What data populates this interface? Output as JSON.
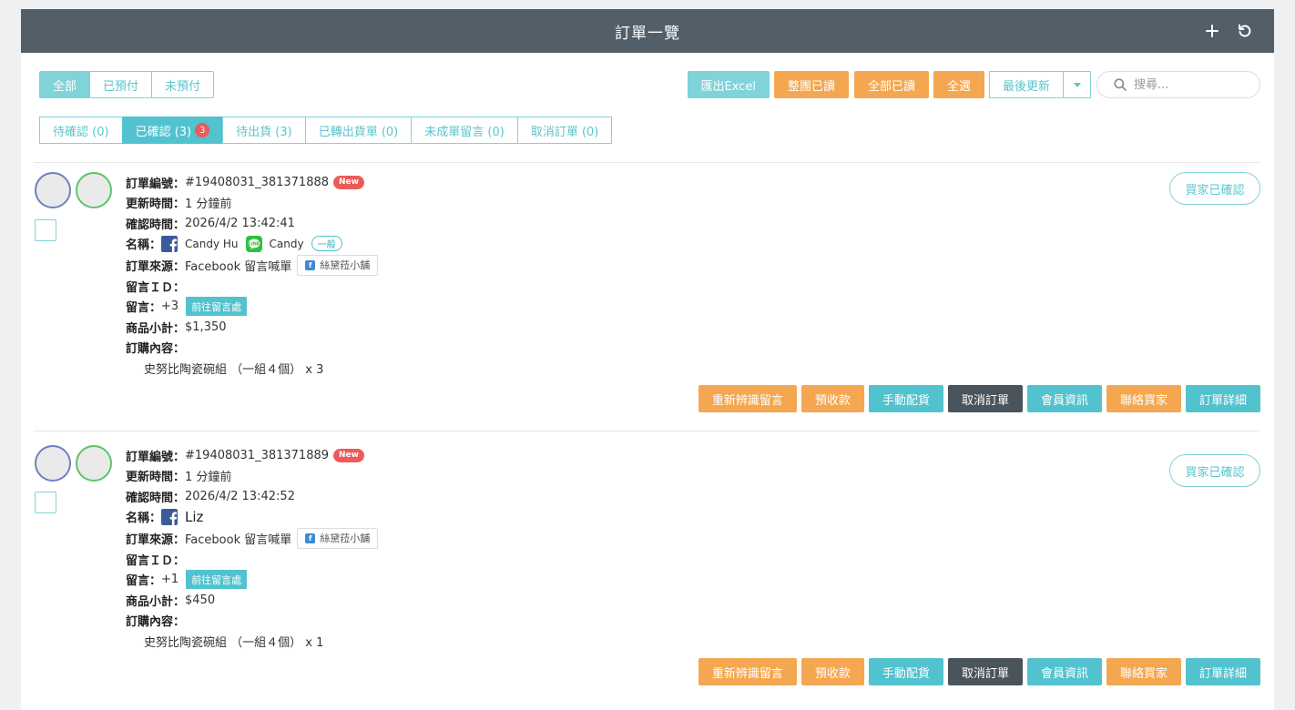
{
  "header": {
    "title": "訂單一覽"
  },
  "filter_tabs": [
    {
      "label": "全部",
      "active": true
    },
    {
      "label": "已預付",
      "active": false
    },
    {
      "label": "未預付",
      "active": false
    }
  ],
  "toolbar": {
    "export_label": "匯出Excel",
    "mark_group_read_label": "整團已讀",
    "mark_all_read_label": "全部已讀",
    "select_all_label": "全選",
    "sort_label": "最後更新",
    "search_placeholder": "搜尋..."
  },
  "status_tabs": [
    {
      "label": "待確認 (0)",
      "active": false
    },
    {
      "label": "已確認 (3)",
      "active": true,
      "badge": "3"
    },
    {
      "label": "待出貨 (3)",
      "active": false
    },
    {
      "label": "已轉出貨單 (0)",
      "active": false
    },
    {
      "label": "未成單留言 (0)",
      "active": false
    },
    {
      "label": "取消訂單 (0)",
      "active": false
    }
  ],
  "labels": {
    "order_no": "訂單編號：",
    "updated": "更新時間：",
    "confirmed_time": "確認時間：",
    "name": "名稱：",
    "source": "訂單來源：",
    "comment_id": "留言ＩＤ：",
    "comment": "留言：",
    "subtotal": "商品小計：",
    "contents": "訂購內容：",
    "new_badge": "New",
    "goto_comment": "前往留言處",
    "buyer_confirmed": "買家已確認"
  },
  "action_buttons": {
    "reidentify": "重新辨識留言",
    "prepay": "預收款",
    "manual_allocate": "手動配貨",
    "cancel_order": "取消訂單",
    "member_info": "會員資訊",
    "contact_buyer": "聯絡買家",
    "order_detail": "訂單詳細"
  },
  "orders": [
    {
      "order_no": "#19408031_381371888",
      "updated": "1 分鐘前",
      "confirmed_time": "2026/4/2 13:42:41",
      "fb_name": "Candy Hu",
      "line_name": "Candy",
      "member_tag": "一般",
      "source": "Facebook 留言喊單",
      "source_page": "絲黛菈小舖",
      "comment_id": "",
      "comment": "+3",
      "subtotal": "$1,350",
      "item": "史努比陶瓷碗組 （一組４個） x 3"
    },
    {
      "order_no": "#19408031_381371889",
      "updated": "1 分鐘前",
      "confirmed_time": "2026/4/2 13:42:52",
      "fb_name": "Liz",
      "source": "Facebook 留言喊單",
      "source_page": "絲黛菈小舖",
      "comment_id": "",
      "comment": "+1",
      "subtotal": "$450",
      "item": "史努比陶瓷碗組 （一組４個） x 1"
    }
  ],
  "colors": {
    "header_bg": "#525e68",
    "teal": "#52c2cf",
    "teal_light": "#80d3d8",
    "orange": "#f4a750",
    "dark": "#4a545c",
    "badge_red": "#ee5a5a",
    "facebook": "#3b5b9a",
    "line": "#2ec03a"
  }
}
